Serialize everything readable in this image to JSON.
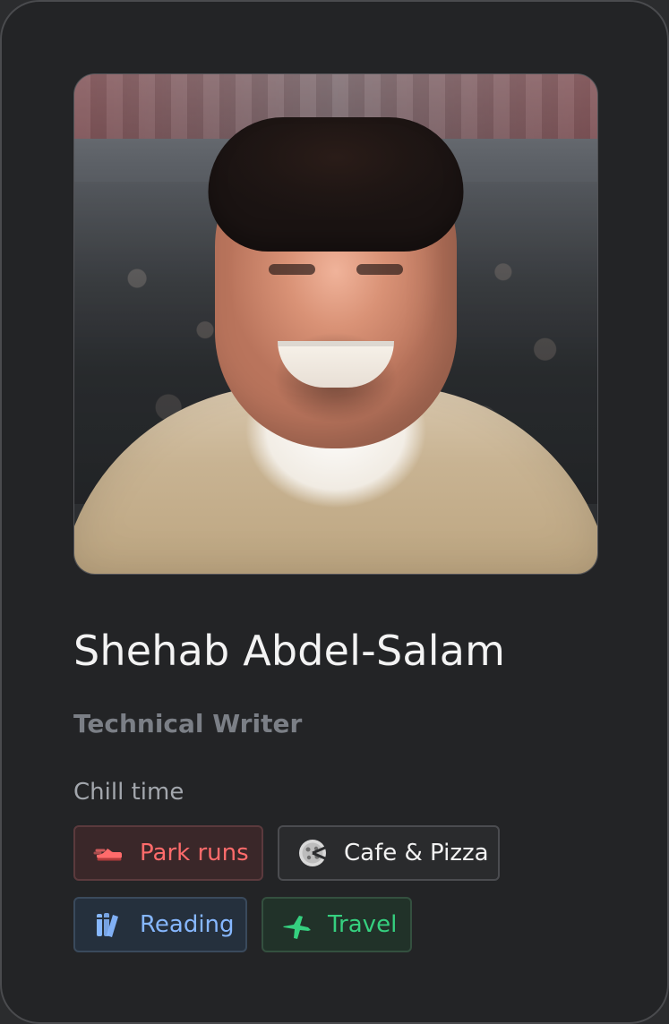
{
  "profile": {
    "name": "Shehab Abdel-Salam",
    "role": "Technical Writer"
  },
  "sections": {
    "interests_title": "Chill time"
  },
  "interests": [
    {
      "label": "Park runs",
      "icon": "sneaker-icon",
      "colors": {
        "text": "#ff6b6b"
      }
    },
    {
      "label": "Cafe & Pizza",
      "icon": "pizza-icon",
      "colors": {
        "text": "#f2f2f2"
      }
    },
    {
      "label": "Reading",
      "icon": "books-icon",
      "colors": {
        "text": "#86b7ff"
      }
    },
    {
      "label": "Travel",
      "icon": "airplane-icon",
      "colors": {
        "text": "#35d07f"
      }
    }
  ]
}
